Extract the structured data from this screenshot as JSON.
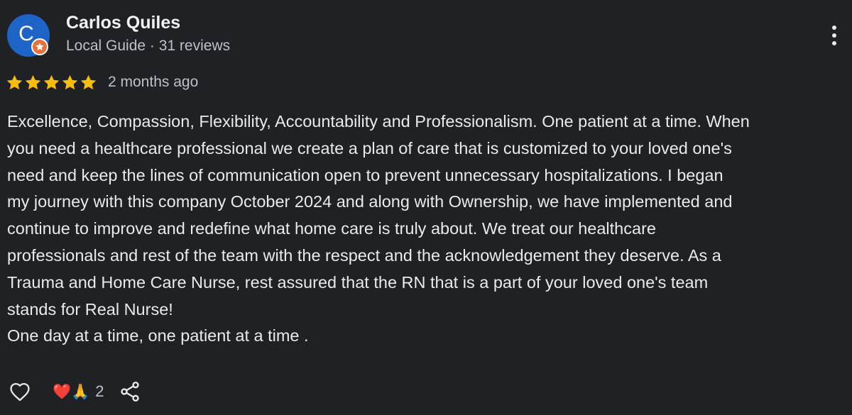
{
  "author": {
    "initial": "C",
    "name": "Carlos Quiles",
    "meta": "Local Guide · 31 reviews",
    "avatar_color": "#1e63c6",
    "badge_color": "#e8703a"
  },
  "rating": {
    "stars": 5,
    "max_stars": 5,
    "star_color": "#fbbc04",
    "date": "2 months ago"
  },
  "review": {
    "lines": [
      "Excellence, Compassion, Flexibility, Accountability and Professionalism. One patient at a time. When",
      "you need a healthcare professional we create a plan of care that is customized to your loved one's",
      "need and keep the lines of communication open to prevent unnecessary hospitalizations. I began",
      "my journey with this company October 2024 and along with Ownership, we have implemented and",
      "continue to improve and redefine what home care is truly about. We treat our healthcare",
      "professionals and rest of the team with the respect and the acknowledgement they deserve. As a",
      "Trauma and Home Care Nurse, rest assured that the RN that is a part of your loved one's team",
      "stands for Real Nurse!",
      "One day at a time, one patient at a time ."
    ]
  },
  "actions": {
    "reaction_emojis": "❤️🙏",
    "reaction_count": "2",
    "icons": [
      "heart-outline-icon",
      "share-icon",
      "more-vertical-icon"
    ]
  }
}
